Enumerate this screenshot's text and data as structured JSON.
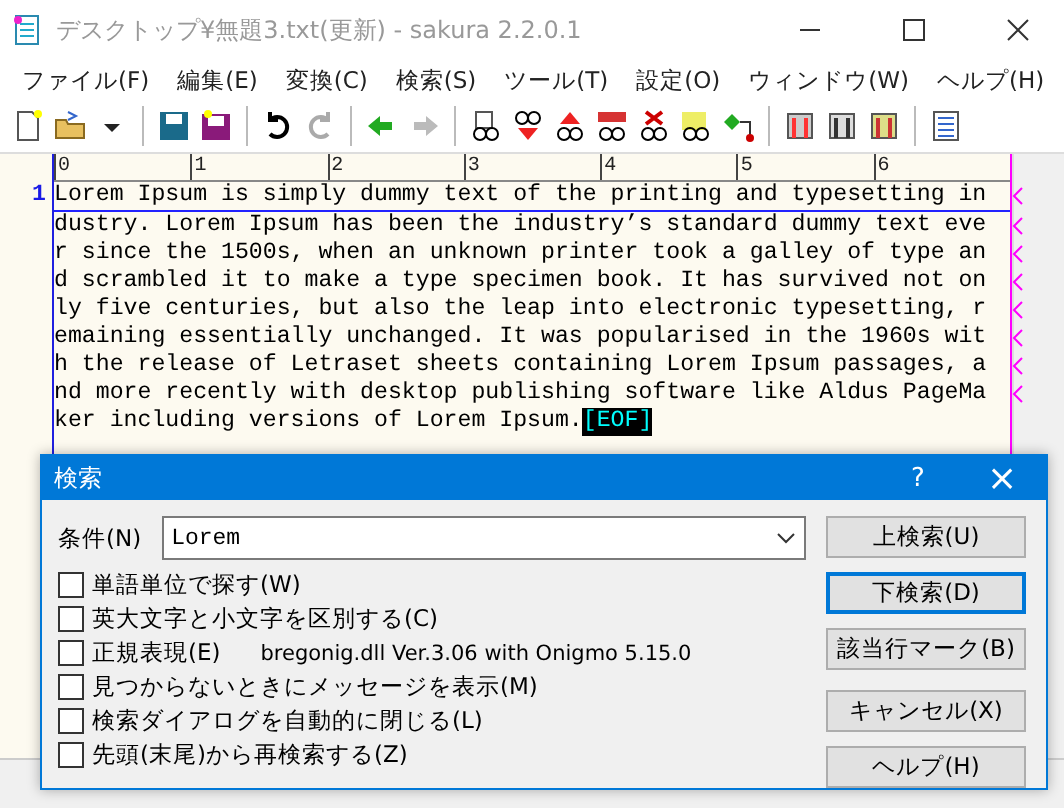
{
  "window": {
    "title": "デスクトップ¥無題3.txt(更新) - sakura 2.2.0.1"
  },
  "menu": [
    "ファイル(F)",
    "編集(E)",
    "変換(C)",
    "検索(S)",
    "ツール(T)",
    "設定(O)",
    "ウィンドウ(W)",
    "ヘルプ(H)"
  ],
  "ruler": [
    "0",
    "1",
    "2",
    "3",
    "4",
    "5",
    "6"
  ],
  "editor": {
    "line_number": "1",
    "lines": [
      "Lorem Ipsum is simply dummy text of the printing and typesetting in",
      "dustry. Lorem Ipsum has been the industry’s standard dummy text eve",
      "r since the 1500s, when an unknown printer took a galley of type an",
      "d scrambled it to make a type specimen book. It has survived not on",
      "ly five centuries, but also the leap into electronic typesetting, r",
      "emaining essentially unchanged. It was popularised in the 1960s wit",
      "h the release of Letraset sheets containing Lorem Ipsum passages, a",
      "nd more recently with desktop publishing software like Aldus PageMa",
      "ker including versions of Lorem Ipsum."
    ],
    "eof": "[EOF]"
  },
  "dialog": {
    "title": "検索",
    "help": "?",
    "close": "×",
    "condition_label": "条件(N)",
    "condition_value": "Lorem",
    "options": [
      {
        "label": "単語単位で探す(W)",
        "checked": false
      },
      {
        "label": "英大文字と小文字を区別する(C)",
        "checked": false
      },
      {
        "label": "正規表現(E)",
        "checked": false,
        "note": "bregonig.dll Ver.3.06 with Onigmo 5.15.0"
      },
      {
        "label": "見つからないときにメッセージを表示(M)",
        "checked": false
      },
      {
        "label": "検索ダイアログを自動的に閉じる(L)",
        "checked": false
      },
      {
        "label": "先頭(末尾)から再検索する(Z)",
        "checked": false
      }
    ],
    "buttons": [
      {
        "label": "上検索(U)",
        "default": false
      },
      {
        "label": "下検索(D)",
        "default": true
      },
      {
        "label": "該当行マーク(B)",
        "default": false
      },
      {
        "label": "キャンセル(X)",
        "default": false
      },
      {
        "label": "ヘルプ(H)",
        "default": false
      }
    ]
  }
}
